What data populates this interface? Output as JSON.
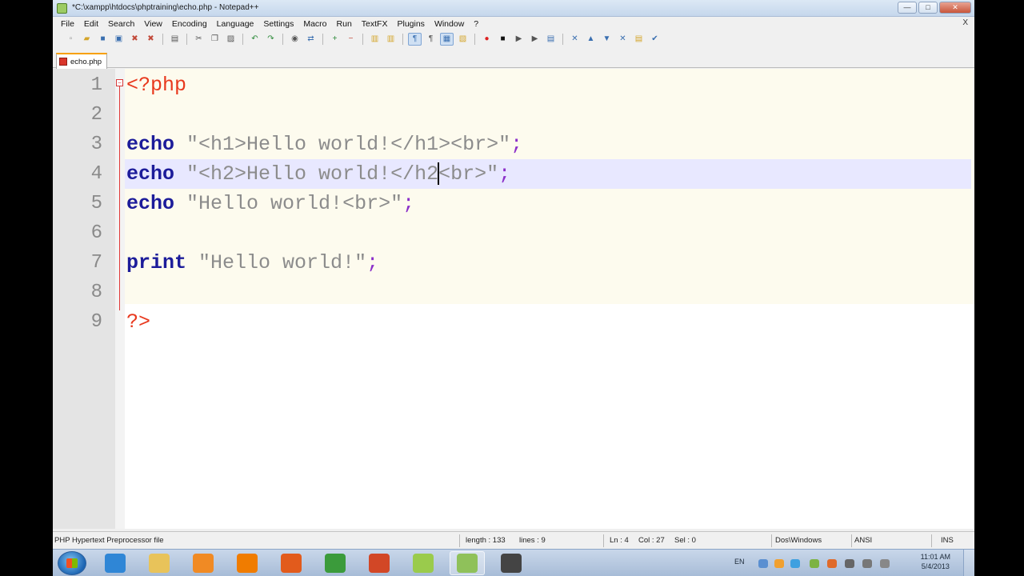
{
  "window": {
    "title": "*C:\\xampp\\htdocs\\phptraining\\echo.php - Notepad++",
    "controls": {
      "minimize": "—",
      "maximize": "□",
      "close": "✕"
    }
  },
  "menu": {
    "items": [
      "File",
      "Edit",
      "Search",
      "View",
      "Encoding",
      "Language",
      "Settings",
      "Macro",
      "Run",
      "TextFX",
      "Plugins",
      "Window",
      "?"
    ],
    "doc_close": "X"
  },
  "toolbar": {
    "buttons": [
      {
        "icon": "new-file-icon",
        "glyph": "▫",
        "color": "#8a8a8a"
      },
      {
        "icon": "open-file-icon",
        "glyph": "▰",
        "color": "#d4a52a"
      },
      {
        "icon": "save-icon",
        "glyph": "■",
        "color": "#3a6fb0"
      },
      {
        "icon": "save-all-icon",
        "glyph": "▣",
        "color": "#3a6fb0"
      },
      {
        "icon": "close-file-icon",
        "glyph": "✖",
        "color": "#c24a3a"
      },
      {
        "icon": "close-all-icon",
        "glyph": "✖",
        "color": "#c24a3a"
      },
      {
        "icon": "print-icon",
        "glyph": "▤",
        "color": "#555"
      },
      {
        "icon": "cut-icon",
        "glyph": "✂",
        "color": "#555"
      },
      {
        "icon": "copy-icon",
        "glyph": "❐",
        "color": "#555"
      },
      {
        "icon": "paste-icon",
        "glyph": "▨",
        "color": "#555"
      },
      {
        "icon": "undo-icon",
        "glyph": "↶",
        "color": "#2d8a3a"
      },
      {
        "icon": "redo-icon",
        "glyph": "↷",
        "color": "#2d8a3a"
      },
      {
        "icon": "find-icon",
        "glyph": "◉",
        "color": "#555"
      },
      {
        "icon": "replace-icon",
        "glyph": "⇄",
        "color": "#3a6fb0"
      },
      {
        "icon": "zoom-in-icon",
        "glyph": "+",
        "color": "#2d8a3a"
      },
      {
        "icon": "zoom-out-icon",
        "glyph": "−",
        "color": "#c24a3a"
      },
      {
        "icon": "sync-vertical-icon",
        "glyph": "▥",
        "color": "#d4a52a"
      },
      {
        "icon": "sync-horizontal-icon",
        "glyph": "▥",
        "color": "#d4a52a"
      },
      {
        "icon": "word-wrap-icon",
        "glyph": "¶",
        "color": "#3a6fb0",
        "pressed": true
      },
      {
        "icon": "show-all-chars-icon",
        "glyph": "¶",
        "color": "#555"
      },
      {
        "icon": "indent-guide-icon",
        "glyph": "▦",
        "color": "#3a6fb0",
        "pressed": true
      },
      {
        "icon": "user-lang-icon",
        "glyph": "▧",
        "color": "#d4a52a"
      },
      {
        "icon": "record-macro-icon",
        "glyph": "●",
        "color": "#d22"
      },
      {
        "icon": "stop-macro-icon",
        "glyph": "■",
        "color": "#111"
      },
      {
        "icon": "play-macro-icon",
        "glyph": "▶",
        "color": "#555"
      },
      {
        "icon": "play-multiple-icon",
        "glyph": "▶",
        "color": "#555"
      },
      {
        "icon": "save-macro-icon",
        "glyph": "▤",
        "color": "#3a6fb0"
      },
      {
        "icon": "textfx-1-icon",
        "glyph": "✕",
        "color": "#3a6fb0"
      },
      {
        "icon": "textfx-2-icon",
        "glyph": "▲",
        "color": "#3a6fb0"
      },
      {
        "icon": "textfx-3-icon",
        "glyph": "▼",
        "color": "#3a6fb0"
      },
      {
        "icon": "textfx-4-icon",
        "glyph": "✕",
        "color": "#3a6fb0"
      },
      {
        "icon": "textfx-5-icon",
        "glyph": "▤",
        "color": "#d4a52a"
      },
      {
        "icon": "textfx-6-icon",
        "glyph": "✔",
        "color": "#3a6fb0"
      }
    ]
  },
  "tabs": [
    {
      "label": "echo.php",
      "modified": true
    }
  ],
  "editor": {
    "current_line": 4,
    "lines": [
      {
        "num": "1",
        "tokens": [
          {
            "t": "<?php",
            "c": "tag"
          }
        ]
      },
      {
        "num": "2",
        "tokens": []
      },
      {
        "num": "3",
        "tokens": [
          {
            "t": "echo",
            "c": "kw"
          },
          {
            "t": " ",
            "c": ""
          },
          {
            "t": "\"<h1>Hello world!</h1><br>\"",
            "c": "str"
          },
          {
            "t": ";",
            "c": "op"
          }
        ]
      },
      {
        "num": "4",
        "tokens": [
          {
            "t": "echo",
            "c": "kw"
          },
          {
            "t": " ",
            "c": ""
          },
          {
            "t": "\"<h2>Hello world!</h2",
            "c": "str"
          },
          {
            "t": "|",
            "c": "caret"
          },
          {
            "t": "<br>\"",
            "c": "str"
          },
          {
            "t": ";",
            "c": "op"
          }
        ]
      },
      {
        "num": "5",
        "tokens": [
          {
            "t": "echo",
            "c": "kw"
          },
          {
            "t": " ",
            "c": ""
          },
          {
            "t": "\"Hello world!<br>\"",
            "c": "str"
          },
          {
            "t": ";",
            "c": "op"
          }
        ]
      },
      {
        "num": "6",
        "tokens": []
      },
      {
        "num": "7",
        "tokens": [
          {
            "t": "print",
            "c": "kw"
          },
          {
            "t": " ",
            "c": ""
          },
          {
            "t": "\"Hello world!\"",
            "c": "str"
          },
          {
            "t": ";",
            "c": "op"
          }
        ]
      },
      {
        "num": "8",
        "tokens": []
      },
      {
        "num": "9",
        "tokens": [
          {
            "t": "?>",
            "c": "tag"
          }
        ]
      }
    ]
  },
  "status": {
    "file_type": "PHP Hypertext Preprocessor file",
    "length": "length : 133",
    "lines": "lines : 9",
    "ln": "Ln : 4",
    "col": "Col : 27",
    "sel": "Sel : 0",
    "eol": "Dos\\Windows",
    "encoding": "ANSI",
    "mode": "INS"
  },
  "taskbar": {
    "apps": [
      {
        "name": "internet-explorer-icon",
        "color": "#2f86d6"
      },
      {
        "name": "file-explorer-icon",
        "color": "#e8c35a"
      },
      {
        "name": "media-player-icon",
        "color": "#f08a24"
      },
      {
        "name": "vlc-icon",
        "color": "#f07c00"
      },
      {
        "name": "firefox-icon",
        "color": "#e25b1c"
      },
      {
        "name": "chrome-icon",
        "color": "#3b9b3b"
      },
      {
        "name": "powerpoint-icon",
        "color": "#d24726"
      },
      {
        "name": "sticky-notes-icon",
        "color": "#9acb4c"
      },
      {
        "name": "notepad-plus-plus-icon",
        "color": "#8fc15a",
        "active": true
      },
      {
        "name": "xampp-icon",
        "color": "#444444"
      }
    ],
    "language": "EN",
    "clock_time": "11:01 AM",
    "clock_date": "5/4/2013"
  }
}
